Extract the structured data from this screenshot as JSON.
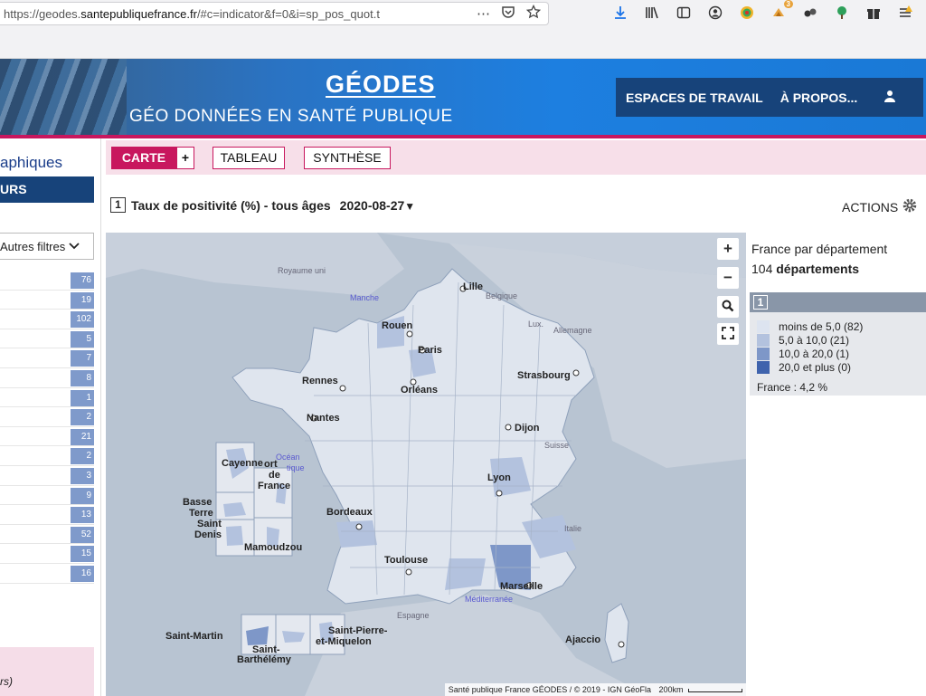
{
  "browser": {
    "url_prefix": "https://geodes.",
    "url_domain": "santepubliquefrance.fr",
    "url_tail": "/#c=indicator&f=0&i=sp_pos_quot.t",
    "overflow": "⋯",
    "extension_badge": "3"
  },
  "header": {
    "title": "GÉODES",
    "subtitle": "GÉO DONNÉES EN SANTÉ PUBLIQUE",
    "nav_workspaces": "ESPACES DE TRAVAIL",
    "nav_about": "À PROPOS...",
    "user_glyph": "♟"
  },
  "sidebar": {
    "title": "aphiques",
    "active_item": "URS",
    "filters_label": "Autres filtres",
    "counts": [
      "76",
      "19",
      "102",
      "5",
      "7",
      "8",
      "1",
      "2",
      "21",
      "2",
      "3",
      "9",
      "13",
      "52",
      "15",
      "16"
    ],
    "footer_text": "rs)"
  },
  "tabs": {
    "carte": "CARTE",
    "plus": "+",
    "tableau": "TABLEAU",
    "synthese": "SYNTHÈSE"
  },
  "indicator": {
    "number": "1",
    "label": "Taux de positivité (%) - tous âges",
    "date": "2020-08-27",
    "actions": "ACTIONS"
  },
  "map": {
    "zoom_in": "+",
    "zoom_out": "−",
    "attribution": "Santé publique France GÉODES / © 2019 - IGN GéoFla",
    "scale": "200km",
    "region_labels": [
      "Royaume uni",
      "Manche",
      "Belgique",
      "Lux.",
      "Allemagne",
      "Suisse",
      "Italie",
      "Océan",
      "tique",
      "Méditerranée",
      "Espagne"
    ],
    "city_labels": [
      "Lille",
      "Rouen",
      "Paris",
      "Strasbourg",
      "Rennes",
      "Orléans",
      "Nantes",
      "Dijon",
      "Lyon",
      "Bordeaux",
      "Toulouse",
      "Marseille",
      "Ajaccio"
    ],
    "overseas": {
      "cayenne": "Cayenne",
      "fort_de_france_1": "ort",
      "fort_de_france_2": "de",
      "fort_de_france_3": "France",
      "basse_terre_1": "Basse",
      "basse_terre_2": "Terre",
      "saint_denis_1": "Saint",
      "saint_denis_2": "Denis",
      "mamoudzou": "Mamoudzou",
      "saint_martin": "Saint-Martin",
      "saint_barthelemy_1": "Saint-",
      "saint_barthelemy_2": "Barthélémy",
      "spm_1": "Saint-Pierre-",
      "spm_2": "et-Miquelon"
    }
  },
  "legend": {
    "scope": "France par département",
    "count_number": "104",
    "count_word": "départements",
    "number": "1",
    "items": [
      {
        "label": "moins de 5,0 (82)",
        "color": "#dde4f0"
      },
      {
        "label": "5,0 à 10,0 (21)",
        "color": "#b3c2de"
      },
      {
        "label": "10,0 à 20,0 (1)",
        "color": "#7e97c8"
      },
      {
        "label": "20,0 et plus (0)",
        "color": "#3f63ad"
      }
    ],
    "total": "France : 4,2 %"
  }
}
